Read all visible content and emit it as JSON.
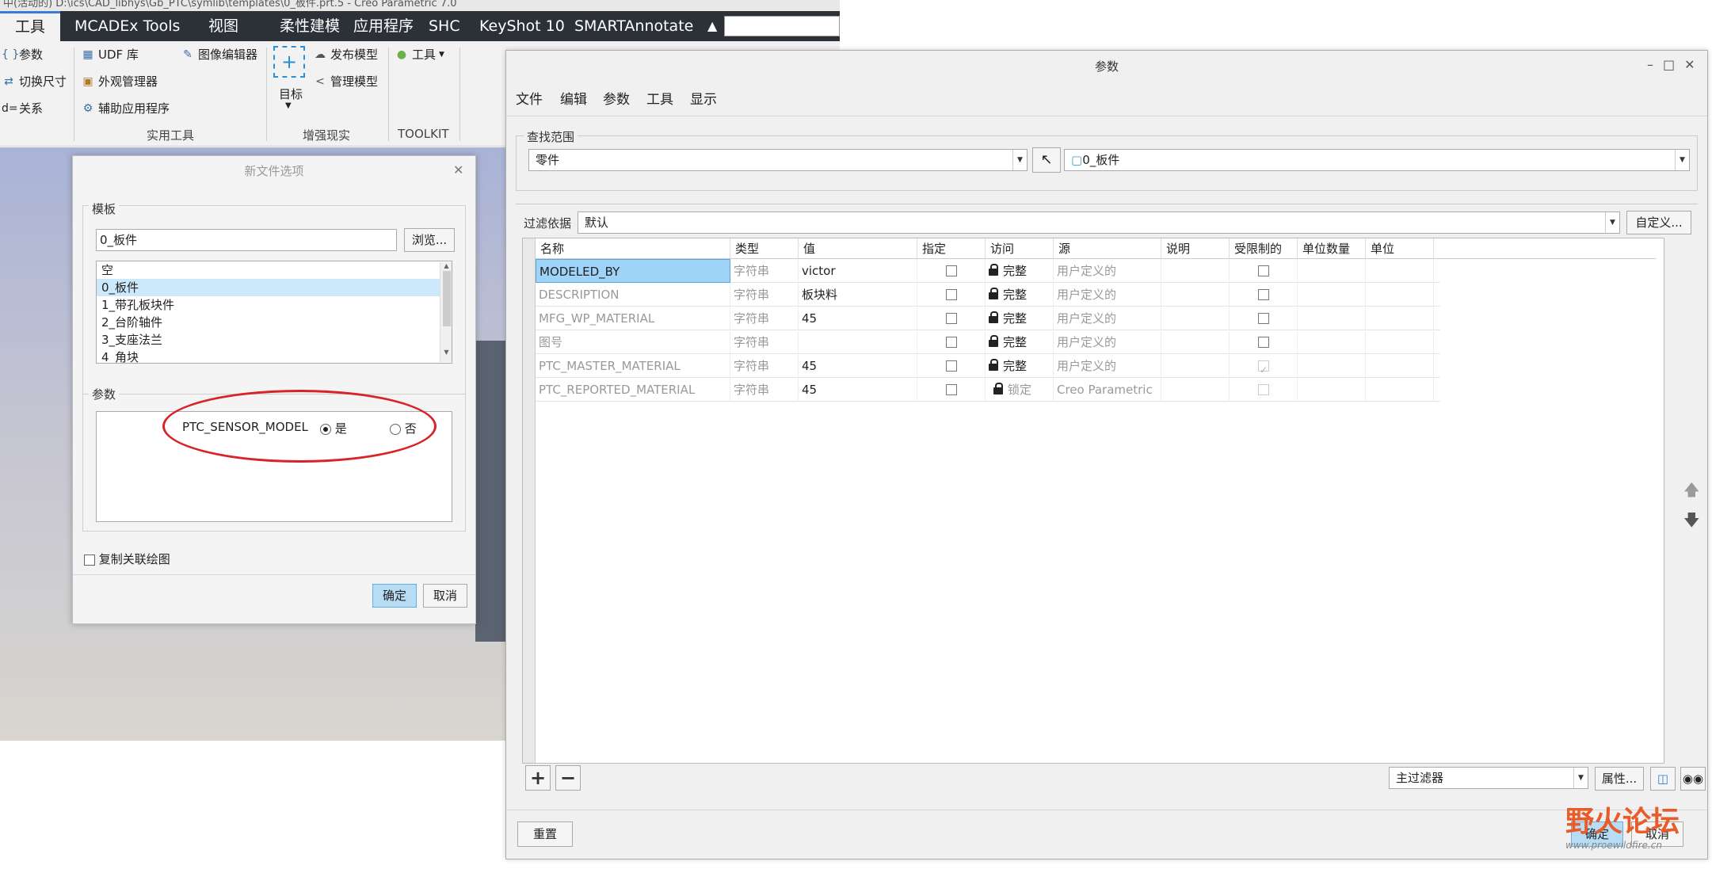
{
  "main_window": {
    "title_text": "中(活动的) D:\\ics\\CAD_libhys\\Gb_PTC\\symlib\\templates\\0_板件.prt.5 - Creo Parametric 7.0",
    "tabs": [
      "工具",
      "MCADEx Tools",
      "视图",
      "柔性建模",
      "应用程序",
      "SHC",
      "KeyShot 10",
      "SMARTAnnotate"
    ],
    "active_tab": "工具",
    "ribbon": {
      "col1": [
        "参数",
        "切换尺寸",
        "关系"
      ],
      "col2": [
        "UDF 库",
        "外观管理器",
        "辅助应用程序"
      ],
      "col3": [
        "图像编辑器"
      ],
      "target_label": "目标",
      "ar_items": [
        "发布模型",
        "管理模型"
      ],
      "tool_item": "工具",
      "groups": [
        "实用工具",
        "增强现实",
        "TOOLKIT"
      ]
    }
  },
  "new_file_dialog": {
    "title": "新文件选项",
    "template_legend": "模板",
    "template_value": "0_板件",
    "browse_label": "浏览...",
    "template_list": [
      "空",
      "0_板件",
      "1_带孔板块件",
      "2_台阶轴件",
      "3_支座法兰",
      "4_角块"
    ],
    "selected_template": "0_板件",
    "params_legend": "参数",
    "param_name": "PTC_SENSOR_MODEL",
    "option_yes": "是",
    "option_no": "否",
    "selected_option": "是",
    "copy_drawing_label": "复制关联绘图",
    "ok_label": "确定",
    "cancel_label": "取消"
  },
  "parameters_dialog": {
    "title": "参数",
    "menu": [
      "文件",
      "编辑",
      "参数",
      "工具",
      "显示"
    ],
    "lookup_label": "查找范围",
    "lookup_type": "零件",
    "lookup_model": "0_板件",
    "filter_label": "过滤依据",
    "filter_value": "默认",
    "customize_label": "自定义...",
    "columns": [
      "名称",
      "类型",
      "值",
      "指定",
      "访问",
      "源",
      "说明",
      "受限制的",
      "单位数量",
      "单位"
    ],
    "rows": [
      {
        "name": "MODELED_BY",
        "type": "字符串",
        "value": "victor",
        "designate": false,
        "access": "完整",
        "source": "用户定义的",
        "restricted": false
      },
      {
        "name": "DESCRIPTION",
        "type": "字符串",
        "value": "板块料",
        "designate": false,
        "access": "完整",
        "source": "用户定义的",
        "restricted": false
      },
      {
        "name": "MFG_WP_MATERIAL",
        "type": "字符串",
        "value": "45",
        "designate": false,
        "access": "完整",
        "source": "用户定义的",
        "restricted": false
      },
      {
        "name": "图号",
        "type": "字符串",
        "value": "",
        "designate": false,
        "access": "完整",
        "source": "用户定义的",
        "restricted": false
      },
      {
        "name": "PTC_MASTER_MATERIAL",
        "type": "字符串",
        "value": "45",
        "designate": false,
        "access": "完整",
        "source": "用户定义的",
        "restricted": true
      },
      {
        "name": "PTC_REPORTED_MATERIAL",
        "type": "字符串",
        "value": "45",
        "designate": false,
        "access": "锁定",
        "source": "Creo Parametric",
        "restricted": false
      }
    ],
    "selected_row": "MODELED_BY",
    "master_filter": "主过滤器",
    "properties_label": "属性...",
    "reset_label": "重置",
    "ok_label": "确定",
    "cancel_label": "取消"
  },
  "watermark": {
    "text": "野火论坛",
    "url": "www.proewildfire.cn"
  }
}
